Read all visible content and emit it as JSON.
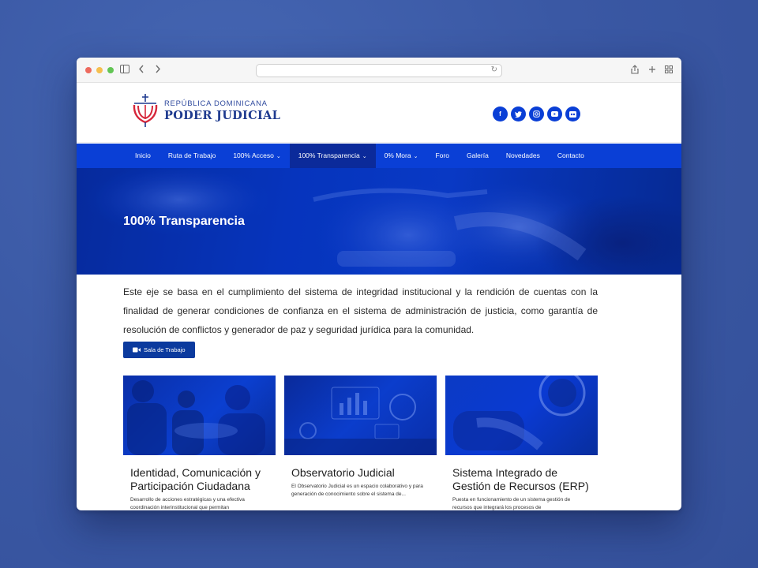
{
  "header": {
    "logo_line1": "REPÚBLICA DOMINICANA",
    "logo_line2": "PODER JUDICIAL"
  },
  "socials": [
    "facebook-icon",
    "twitter-icon",
    "instagram-icon",
    "youtube-icon",
    "flickr-icon"
  ],
  "nav": {
    "items": [
      {
        "label": "Inicio"
      },
      {
        "label": "Ruta de Trabajo"
      },
      {
        "label": "100% Acceso"
      },
      {
        "label": "100% Transparencia"
      },
      {
        "label": "0% Mora"
      },
      {
        "label": "Foro"
      },
      {
        "label": "Galería"
      },
      {
        "label": "Novedades"
      },
      {
        "label": "Contacto"
      }
    ]
  },
  "hero": {
    "title": "100% Transparencia"
  },
  "main": {
    "intro": "Este eje se basa en el cumplimiento del sistema de integridad institucional y la rendición de cuentas con la finalidad de generar condiciones de confianza en el sistema de administración de justicia, como garantía de resolución de conflictos y generador de paz y seguridad jurídica para la comunidad.",
    "button_label": "Sala de Trabajo"
  },
  "cards": [
    {
      "title": "Identidad, Comunicación y Participación Ciudadana",
      "desc": "Desarrollo de acciones estratégicas y una efectiva coordinación interinstitucional que permitan"
    },
    {
      "title": "Observatorio Judicial",
      "desc": "El Observatorio Judicial es un espacio colaborativo y para generación de conocimiento sobre el sistema de..."
    },
    {
      "title": "Sistema Integrado de Gestión de Recursos (ERP)",
      "desc": "Puesta en funcionamiento de un sistema gestión de recursos que integrará los procesos de"
    }
  ],
  "colors": {
    "nav_bg": "#0a3fd6",
    "nav_active": "#0b2a9a",
    "button": "#0b3a9e",
    "brand_red": "#d6263a"
  }
}
